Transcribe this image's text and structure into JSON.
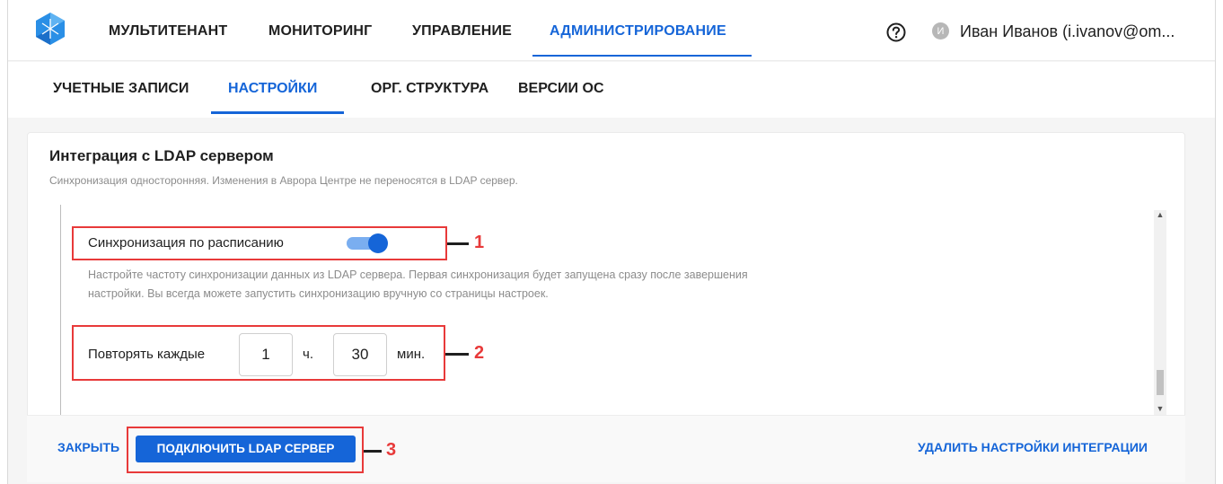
{
  "topnav": {
    "items": [
      "МУЛЬТИТЕНАНТ",
      "МОНИТОРИНГ",
      "УПРАВЛЕНИЕ",
      "АДМИНИСТРИРОВАНИЕ"
    ],
    "user_initial": "И",
    "user_name": "Иван Иванов (i.ivanov@om..."
  },
  "subnav": {
    "items": [
      "УЧЕТНЫЕ ЗАПИСИ",
      "НАСТРОЙКИ",
      "ОРГ. СТРУКТУРА",
      "ВЕРСИИ ОС"
    ]
  },
  "card": {
    "title": "Интеграция с LDAP сервером",
    "subtitle": "Синхронизация односторонняя. Изменения в Аврора Центре не переносятся в LDAP сервер.",
    "schedule_label": "Синхронизация по расписанию",
    "schedule_enabled": true,
    "hint": "Настройте частоту синхронизации данных из LDAP сервера. Первая синхронизация будет запущена сразу после завершения настройки. Вы всегда можете запустить синхронизацию вручную со страницы настроек.",
    "repeat_label": "Повторять каждые",
    "hours_value": "1",
    "hours_unit": "ч.",
    "minutes_value": "30",
    "minutes_unit": "мин."
  },
  "footer": {
    "close_label": "ЗАКРЫТЬ",
    "connect_label": "ПОДКЛЮЧИТЬ LDAP СЕРВЕР",
    "delete_label": "УДАЛИТЬ НАСТРОЙКИ ИНТЕГРАЦИИ"
  },
  "callouts": [
    "1",
    "2",
    "3"
  ],
  "colors": {
    "accent": "#1565d8",
    "callout": "#e83a3a"
  },
  "icons": [
    "app-logo-icon",
    "help-icon",
    "scroll-up-icon",
    "scroll-down-icon"
  ]
}
